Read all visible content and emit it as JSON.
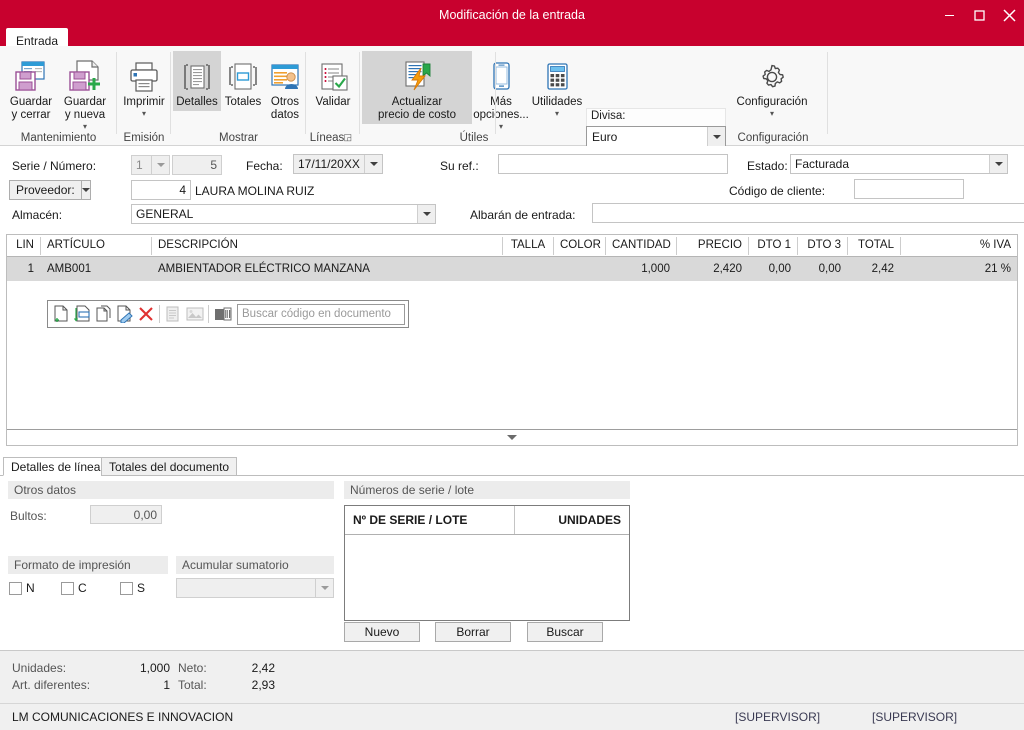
{
  "window": {
    "title": "Modificación de la entrada",
    "minimize_icon": "minimize-icon",
    "maximize_icon": "maximize-icon",
    "close_icon": "close-icon",
    "accent_color": "#c8012e"
  },
  "ribbon": {
    "tab_label": "Entrada",
    "groups": [
      {
        "name": "Mantenimiento",
        "label": "Mantenimiento"
      },
      {
        "name": "Emision",
        "label": "Emisión"
      },
      {
        "name": "Mostrar",
        "label": "Mostrar"
      },
      {
        "name": "Lineas",
        "label": "Líneas"
      },
      {
        "name": "Utiles",
        "label": "Útiles"
      },
      {
        "name": "Configuracion",
        "label": "Configuración"
      }
    ],
    "buttons": {
      "guardar_y_cerrar": "Guardar\ny cerrar",
      "guardar_y_nueva": "Guardar\ny nueva",
      "imprimir": "Imprimir",
      "detalles": "Detalles",
      "totales": "Totales",
      "otros_datos": "Otros\ndatos",
      "validar": "Validar",
      "actualizar_precio": "Actualizar\nprecio de costo",
      "mas_opciones": "Más\nopciones...",
      "utilidades": "Utilidades",
      "configuracion": "Configuración"
    },
    "divisa": {
      "label": "Divisa:",
      "value": "Euro"
    }
  },
  "form": {
    "serie_numero_label": "Serie / Número:",
    "serie_value": "1",
    "numero_value": "5",
    "fecha_label": "Fecha:",
    "fecha_value": "17/11/20XX",
    "su_ref_label": "Su ref.:",
    "su_ref_value": "",
    "estado_label": "Estado:",
    "estado_value": "Facturada",
    "proveedor_label": "Proveedor:",
    "proveedor_code": "4",
    "proveedor_name": "LAURA MOLINA RUIZ",
    "codigo_cliente_label": "Código de cliente:",
    "codigo_cliente_value": "",
    "almacen_label": "Almacén:",
    "almacen_value": "GENERAL",
    "albaran_label": "Albarán de entrada:",
    "albaran_value": ""
  },
  "grid": {
    "columns": [
      "LIN",
      "ARTÍCULO",
      "DESCRIPCIÓN",
      "TALLA",
      "COLOR",
      "CANTIDAD",
      "PRECIO",
      "DTO 1",
      "DTO 3",
      "TOTAL",
      "% IVA"
    ],
    "rows": [
      {
        "lin": "1",
        "articulo": "AMB001",
        "descripcion": "AMBIENTADOR ELÉCTRICO MANZANA",
        "talla": "",
        "color": "",
        "cantidad": "1,000",
        "precio": "2,420",
        "dto1": "0,00",
        "dto3": "0,00",
        "total": "2,42",
        "iva": "21 %"
      }
    ],
    "line_toolbar": {
      "icons": [
        "new-document-icon",
        "insert-document-icon",
        "copy-document-icon",
        "edit-document-icon",
        "delete-document-icon",
        "notes-icon",
        "image-icon",
        "barcode-icon"
      ],
      "search_placeholder": "Buscar código en documento"
    },
    "collapse_icon": "chevron-down-icon"
  },
  "bottom_tabs": [
    {
      "label": "Detalles de línea",
      "active": true
    },
    {
      "label": "Totales del documento",
      "active": false
    }
  ],
  "details": {
    "otros_datos_title": "Otros datos",
    "bultos_label": "Bultos:",
    "bultos_value": "0,00",
    "formato_title": "Formato de impresión",
    "formato_options": [
      "N",
      "C",
      "S"
    ],
    "acumular_title": "Acumular sumatorio",
    "acumular_value": "",
    "serie_panel_title": "Números de serie / lote",
    "serie_columns": [
      "Nº DE SERIE / LOTE",
      "UNIDADES"
    ],
    "serie_rows": [],
    "serie_buttons": [
      "Nuevo",
      "Borrar",
      "Buscar"
    ]
  },
  "status": {
    "unidades_label": "Unidades:",
    "unidades_value": "1,000",
    "neto_label": "Neto:",
    "neto_value": "2,42",
    "art_diferentes_label": "Art. diferentes:",
    "art_diferentes_value": "1",
    "total_label": "Total:",
    "total_value": "2,93",
    "company": "LM COMUNICACIONES E INNOVACION",
    "user_left": "[SUPERVISOR]",
    "user_right": "[SUPERVISOR]"
  }
}
